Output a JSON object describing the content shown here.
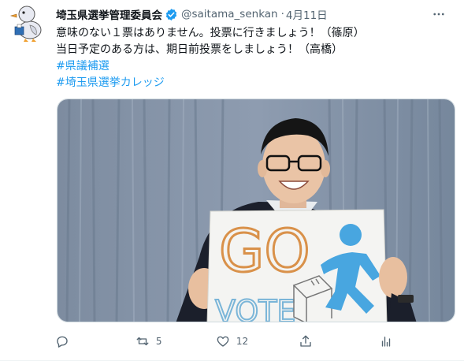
{
  "tweet": {
    "author_name": "埼玉県選挙管理委員会",
    "handle": "@saitama_senkan",
    "separator": "·",
    "date": "4月11日",
    "text_lines": [
      "意味のない１票はありません。投票に行きましょう！（篠原）",
      "当日予定のある方は、期日前投票をしましょう！（高橋）"
    ],
    "hashtags": [
      "#県議補選",
      "#埼玉県選挙カレッジ"
    ],
    "image_text": {
      "sign_go": "GO",
      "sign_vote": "VOTE"
    }
  },
  "actions": {
    "reply_count": "",
    "retweet_count": "5",
    "like_count": "12",
    "share_count": ""
  },
  "colors": {
    "link": "#1d9bf0",
    "secondary_text": "#536471",
    "verified": "#1d9bf0",
    "border": "#cfd9de"
  },
  "icons": {
    "avatar": "duck-mascot-avatar",
    "verified": "verified-badge-icon",
    "more": "more-icon",
    "reply": "reply-icon",
    "retweet": "retweet-icon",
    "like": "like-icon",
    "share": "share-icon",
    "analytics": "analytics-icon"
  }
}
